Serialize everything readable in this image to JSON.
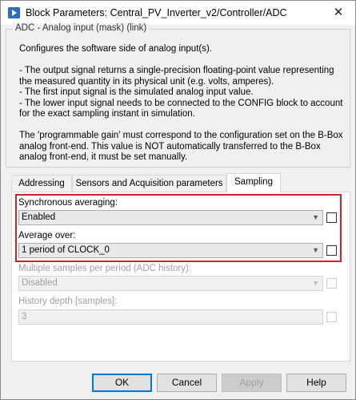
{
  "window": {
    "title": "Block Parameters: Central_PV_Inverter_v2/Controller/ADC",
    "close_glyph": "✕"
  },
  "description": {
    "legend": "ADC - Analog input (mask) (link)",
    "lines": [
      "Configures the software side of analog input(s).",
      "",
      "- The output signal returns a single-precision floating-point value representing the measured quantity in its physical unit (e.g. volts, amperes).",
      "- The first input signal is the simulated analog input value.",
      "- The lower input signal needs to be connected to the CONFIG block to account for the exact sampling instant in simulation.",
      "",
      "The 'programmable gain' must correspond to the configuration set on the B-Box analog front-end. This value is NOT automatically transferred to the B-Box analog front-end, it must be set manually."
    ]
  },
  "tabs": [
    {
      "label": "Addressing",
      "active": false
    },
    {
      "label": "Sensors and Acquisition parameters",
      "active": false
    },
    {
      "label": "Sampling",
      "active": true
    }
  ],
  "sampling": {
    "sync_avg_label": "Synchronous averaging:",
    "sync_avg_value": "Enabled",
    "avg_over_label": "Average over:",
    "avg_over_value": "1 period of CLOCK_0",
    "multi_samples_label": "Multiple samples per period (ADC history):",
    "multi_samples_value": "Disabled",
    "history_depth_label": "History depth [samples]:",
    "history_depth_value": "3"
  },
  "buttons": {
    "ok": "OK",
    "cancel": "Cancel",
    "apply": "Apply",
    "help": "Help"
  },
  "colors": {
    "highlight_border": "#d1212b",
    "default_button_border": "#0078d7"
  },
  "icons": {
    "dropdown": "▼"
  }
}
